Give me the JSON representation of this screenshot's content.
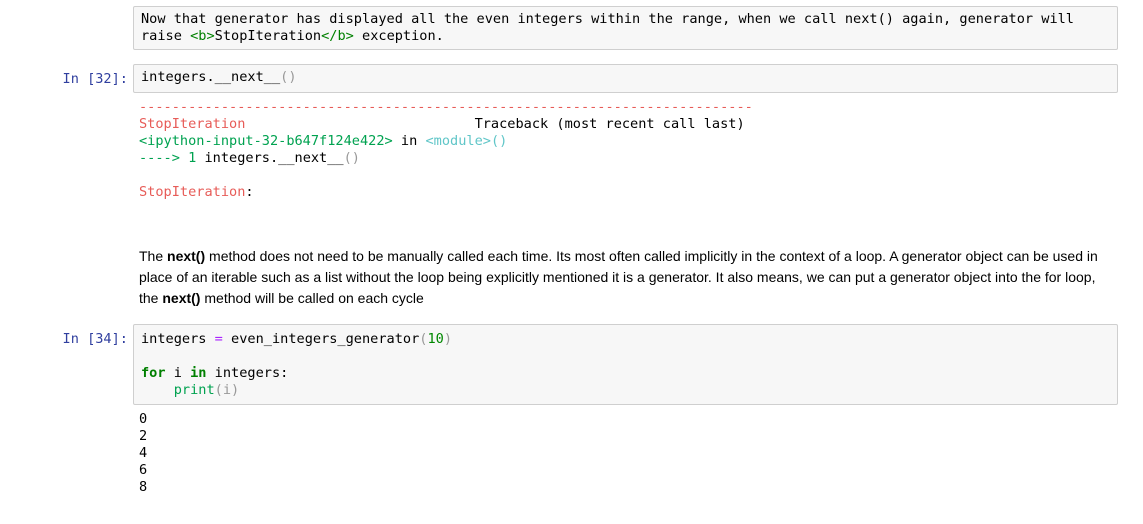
{
  "markdown_raw": {
    "line1": "Now that generator has displayed all the even integers within the range, when we call next() again, generator will",
    "line2_pre": "raise ",
    "tag_open": "<b>",
    "tag_content": "StopIteration",
    "tag_close": "</b>",
    "line2_post": " exception."
  },
  "cell32": {
    "prompt": "In [32]:",
    "code_pre": "integers.",
    "code_method": "__next__",
    "code_parens": "()"
  },
  "traceback": {
    "dashes": "---------------------------------------------------------------------------",
    "error_name": "StopIteration",
    "header_right": "Traceback (most recent call last)",
    "input_ref": "<ipython-input-32-b647f124e422>",
    "in_word": " in ",
    "module": "<module>",
    "module_parens": "()",
    "arrow": "---->",
    "line_no": " 1 ",
    "line_code": "integers.__next__",
    "line_parens": "()",
    "final_error": "StopIteration",
    "final_colon": ":"
  },
  "markdown_text": {
    "p1": "The ",
    "b1": "next()",
    "p2": " method does not need to be manually called each time. Its most often called implicitly in the context of a loop. A generator object can be used in place of an iterable such as a list without the loop being explicitly mentioned it is a generator. It also means, we can put a generator object into the for loop, the ",
    "b2": "next()",
    "p3": " method will be called on each cycle"
  },
  "cell34": {
    "prompt": "In [34]:",
    "line1_var": "integers ",
    "line1_op": "=",
    "line1_call": " even_integers_generator",
    "line1_paren_open": "(",
    "line1_num": "10",
    "line1_paren_close": ")",
    "line3_for": "for",
    "line3_i": " i ",
    "line3_in": "in",
    "line3_rest": " integers:",
    "line4_indent": "    ",
    "line4_print": "print",
    "line4_args": "(i)"
  },
  "output34": [
    "0",
    "2",
    "4",
    "6",
    "8"
  ]
}
